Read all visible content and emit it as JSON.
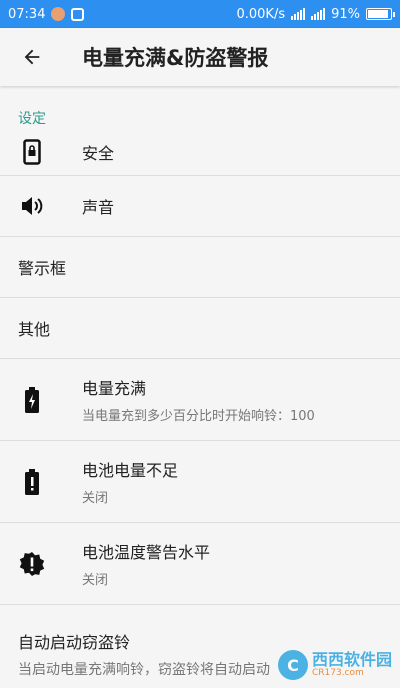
{
  "statusbar": {
    "time": "07:34",
    "network_speed": "0.00K/s",
    "signal_top_label": "4G+",
    "signal_bottom_label": "4G",
    "battery_percent": "91%",
    "battery_level": 0.91
  },
  "appbar": {
    "title": "电量充满&防盗警报",
    "back_icon": "arrow-left-icon"
  },
  "section": {
    "header": "设定"
  },
  "rows": [
    {
      "title": "安全",
      "icon": "phone-lock-icon"
    },
    {
      "title": "声音",
      "icon": "speaker-icon"
    },
    {
      "title": "警示框"
    },
    {
      "title": "其他"
    },
    {
      "title": "电量充满",
      "subtitle": "当电量充到多少百分比时开始响铃：100",
      "icon": "battery-charging-icon"
    },
    {
      "title": "电池电量不足",
      "subtitle": "关闭",
      "icon": "battery-alert-icon"
    },
    {
      "title": "电池温度警告水平",
      "subtitle": "关闭",
      "icon": "alert-badge-icon"
    },
    {
      "title": "自动启动窃盗铃",
      "subtitle": "当启动电量充满响铃，窃盗铃将自动启动"
    }
  ],
  "watermark": {
    "brand": "西西软件园",
    "url": "CR173.com"
  },
  "colors": {
    "statusbar": "#2d8ff0",
    "accent": "#2a9d8f",
    "background": "#f5f5f5"
  }
}
